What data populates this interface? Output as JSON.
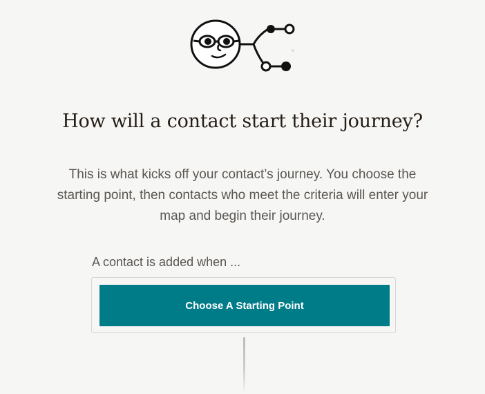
{
  "illustration": {
    "icon": "face-with-sunglasses-branching-nodes-icon"
  },
  "page": {
    "heading": "How will a contact start their journey?",
    "description": "This is what kicks off your contact’s journey. You choose the starting point, then contacts who meet the criteria will enter your map and begin their journey."
  },
  "trigger": {
    "label": "A contact is added when ...",
    "button_label": "Choose A Starting Point"
  },
  "colors": {
    "accent": "#007c89",
    "background": "#f6f6f4",
    "heading_text": "#241c15",
    "body_text": "#5a5651"
  }
}
